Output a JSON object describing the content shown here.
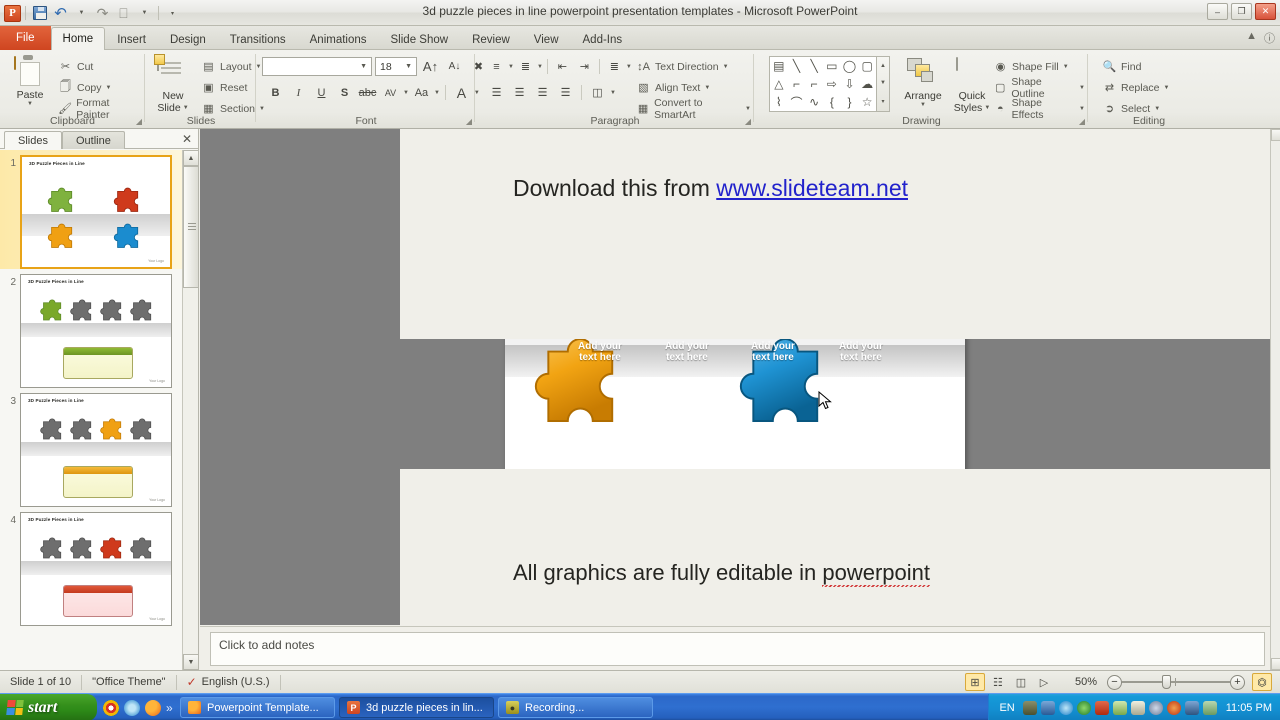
{
  "titlebar": {
    "app_icon": "powerpoint-logo",
    "title": "3d puzzle pieces in line powerpoint presentation templates  -  Microsoft PowerPoint",
    "qat": [
      {
        "name": "save",
        "icon": "save-icon"
      },
      {
        "name": "undo",
        "icon": "undo-icon"
      },
      {
        "name": "redo",
        "icon": "redo-icon"
      },
      {
        "name": "print-preview",
        "icon": "print-icon"
      },
      {
        "name": "customize-qat",
        "icon": "chevron-down-icon"
      }
    ],
    "window_buttons": {
      "minimize": "–",
      "restore": "❐",
      "close": "✕"
    }
  },
  "tabs": [
    {
      "label": "File",
      "id": "file"
    },
    {
      "label": "Home",
      "id": "home"
    },
    {
      "label": "Insert",
      "id": "insert"
    },
    {
      "label": "Design",
      "id": "design"
    },
    {
      "label": "Transitions",
      "id": "transitions"
    },
    {
      "label": "Animations",
      "id": "animations"
    },
    {
      "label": "Slide Show",
      "id": "slideshow"
    },
    {
      "label": "Review",
      "id": "review"
    },
    {
      "label": "View",
      "id": "view"
    },
    {
      "label": "Add-Ins",
      "id": "addins"
    }
  ],
  "ribbon": {
    "clipboard": {
      "group_label": "Clipboard",
      "paste_label": "Paste",
      "items": [
        {
          "label": "Cut",
          "icon": "scissors-icon"
        },
        {
          "label": "Copy",
          "icon": "copy-icon"
        },
        {
          "label": "Format Painter",
          "icon": "paintbrush-icon"
        }
      ]
    },
    "slides": {
      "group_label": "Slides",
      "new_slide_label": "New\nSlide",
      "new_slide_line1": "New",
      "new_slide_line2": "Slide",
      "items": [
        {
          "label": "Layout",
          "icon": "layout-icon"
        },
        {
          "label": "Reset",
          "icon": "reset-icon"
        },
        {
          "label": "Section",
          "icon": "section-icon"
        }
      ]
    },
    "font": {
      "group_label": "Font",
      "font_name": "",
      "font_size": "18",
      "buttons": [
        "B",
        "I",
        "U",
        "S",
        "abc",
        "AV",
        "Aa",
        "A"
      ]
    },
    "paragraph": {
      "group_label": "Paragraph",
      "items": [
        {
          "label": "Text Direction",
          "icon": "text-direction-icon"
        },
        {
          "label": "Align Text",
          "icon": "align-text-icon"
        },
        {
          "label": "Convert to SmartArt",
          "icon": "smartart-icon"
        }
      ]
    },
    "drawing": {
      "group_label": "Drawing",
      "arrange_label": "Arrange",
      "quick_styles_line1": "Quick",
      "quick_styles_line2": "Styles",
      "items": [
        {
          "label": "Shape Fill",
          "icon": "shape-fill-icon"
        },
        {
          "label": "Shape Outline",
          "icon": "shape-outline-icon"
        },
        {
          "label": "Shape Effects",
          "icon": "shape-effects-icon"
        }
      ],
      "shapes": [
        "▤",
        "╲",
        "╲",
        "▭",
        "◯",
        "▢",
        "△",
        "⌐",
        "⌐",
        "⇨",
        "⇩",
        "☁",
        "⌇",
        "⌒",
        "∿",
        "{",
        "}",
        "☆"
      ]
    },
    "editing": {
      "group_label": "Editing",
      "items": [
        {
          "label": "Find",
          "icon": "binoculars-icon"
        },
        {
          "label": "Replace",
          "icon": "replace-icon"
        },
        {
          "label": "Select",
          "icon": "select-arrow-icon"
        }
      ]
    },
    "help_icons": [
      "minimize-ribbon-icon",
      "help-icon"
    ]
  },
  "left_pane": {
    "tab_slides": "Slides",
    "tab_outline": "Outline",
    "close_icon": "close-icon",
    "thumbnails": [
      {
        "number": "1",
        "title": "3D Puzzle  Pieces in Line",
        "logo": "Your Logo",
        "selected": true
      },
      {
        "number": "2",
        "title": "3D Puzzle Pieces in Line",
        "logo": "Your Logo",
        "selected": false
      },
      {
        "number": "3",
        "title": "3D Puzzle Pieces in Line",
        "logo": "Your Logo",
        "selected": false
      },
      {
        "number": "4",
        "title": "3D Puzzle Pieces in Line",
        "logo": "Your Logo",
        "selected": false
      }
    ]
  },
  "slide": {
    "download_prefix": "Download this from ",
    "download_link": "www.slideteam.net",
    "bottom_text_prefix": "All graphics are fully editable in ",
    "bottom_text_misspelled": "powerpoint",
    "title": "3D Puzzle  Pieces in Line",
    "logo": "Your Logo",
    "placeholders": [
      {
        "line1": "Add your",
        "line2": "text here"
      },
      {
        "line1": "Add your",
        "line2": "text here"
      },
      {
        "line1": "Add your",
        "line2": "text here"
      },
      {
        "line1": "Add your",
        "line2": "text here"
      }
    ],
    "pieces": [
      {
        "name": "green-puzzle-piece",
        "color": "#7fb23f"
      },
      {
        "name": "red-puzzle-piece",
        "color": "#cf3a1c"
      },
      {
        "name": "orange-puzzle-piece",
        "color": "#f0a013"
      },
      {
        "name": "blue-puzzle-piece",
        "color": "#1b8ccf"
      }
    ]
  },
  "notes": {
    "placeholder": "Click to add notes"
  },
  "status": {
    "slide_count": "Slide 1 of 10",
    "theme": "\"Office Theme\"",
    "language": "English (U.S.)",
    "spellcheck_icon": "spellcheck-icon",
    "view_buttons": [
      {
        "name": "normal-view",
        "icon": "⊞",
        "active": true
      },
      {
        "name": "slide-sorter-view",
        "icon": "☷"
      },
      {
        "name": "reading-view",
        "icon": "◫"
      },
      {
        "name": "slide-show-view",
        "icon": "▷"
      }
    ],
    "zoom_level": "50%",
    "zoom_out_icon": "−",
    "zoom_in_icon": "+",
    "fit_icon": "fit-slide-icon"
  },
  "taskbar": {
    "start_label": "start",
    "quick_launch": [
      "chrome-icon",
      "internet-explorer-icon",
      "firefox-icon",
      "more-icon"
    ],
    "windows": [
      {
        "label": "Powerpoint Template...",
        "icon": "firefox-icon",
        "active": false
      },
      {
        "label": "3d puzzle pieces in lin...",
        "icon": "powerpoint-icon",
        "active": true
      },
      {
        "label": "Recording...",
        "icon": "recorder-icon",
        "active": false
      }
    ],
    "tray_language": "EN",
    "tray_icons": [
      "printer-icon",
      "network-icon",
      "power-icon",
      "globe-icon",
      "volume-mute-icon",
      "message-icon",
      "screen-icon",
      "clock-icon",
      "opera-icon",
      "save-icon",
      "monitor-icon"
    ],
    "clock": "11:05 PM"
  }
}
